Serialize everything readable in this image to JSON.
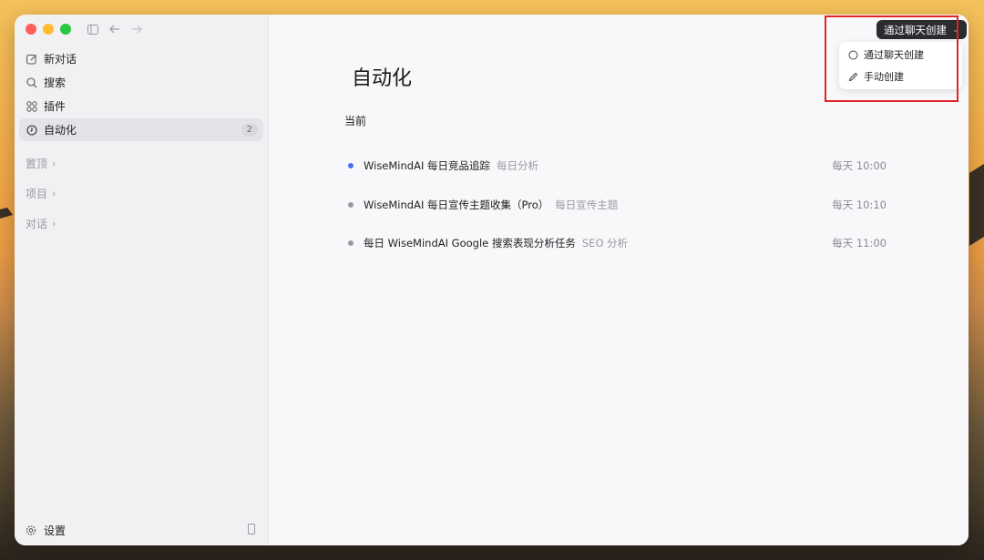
{
  "toolbar": {
    "sidebar_toggle_icon": "sidebar-toggle-icon",
    "back_icon": "arrow-left-icon",
    "forward_icon": "arrow-right-icon"
  },
  "sidebar": {
    "items": [
      {
        "label": "新对话",
        "icon": "edit-icon"
      },
      {
        "label": "搜索",
        "icon": "search-icon"
      },
      {
        "label": "插件",
        "icon": "grid-icon"
      },
      {
        "label": "自动化",
        "icon": "clock-icon",
        "count": "2",
        "active": true
      }
    ],
    "sections": [
      {
        "label": "置顶"
      },
      {
        "label": "项目"
      },
      {
        "label": "对话"
      }
    ],
    "footer": {
      "label": "设置",
      "icon": "gear-icon",
      "right_icon": "phone-icon"
    }
  },
  "main": {
    "title": "自动化",
    "section_label": "当前",
    "tasks": [
      {
        "name": "WiseMindAI 每日竞品追踪",
        "tag": "每日分析",
        "time": "每天 10:00",
        "dot_color": "#4a6cf7"
      },
      {
        "name": "WiseMindAI 每日宣传主题收集（Pro）",
        "tag": "每日宣传主题",
        "time": "每天 10:10",
        "dot_color": "#9a9aa0"
      },
      {
        "name": "每日 WiseMindAI Google 搜索表现分析任务",
        "tag": "SEO 分析",
        "time": "每天 11:00",
        "dot_color": "#9a9aa0"
      }
    ]
  },
  "create": {
    "button_label": "通过聊天创建",
    "menu": [
      {
        "label": "通过聊天创建",
        "icon": "chat-bubble-icon"
      },
      {
        "label": "手动创建",
        "icon": "pencil-icon"
      }
    ]
  },
  "colors": {
    "highlight": "#e0242a",
    "active_dot": "#4a6cf7"
  }
}
